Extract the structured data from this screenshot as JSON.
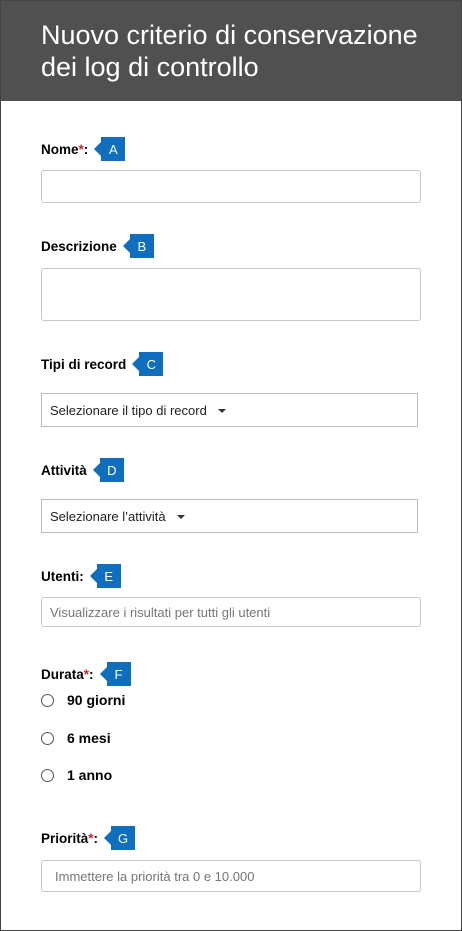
{
  "header": {
    "title": "Nuovo criterio di conservazione dei log di controllo"
  },
  "form": {
    "name": {
      "label": "Nome",
      "required_mark": "*",
      "colon": ":",
      "callout": "A",
      "value": ""
    },
    "description": {
      "label": "Descrizione",
      "callout": "B",
      "value": ""
    },
    "record_types": {
      "label": "Tipi di record",
      "callout": "C",
      "selected": "Selezionare il tipo di record"
    },
    "activities": {
      "label": "Attività",
      "callout": "D",
      "selected": "Selezionare l’attività"
    },
    "users": {
      "label": "Utenti:",
      "callout": "E",
      "placeholder": "Visualizzare i risultati per tutti gli utenti"
    },
    "duration": {
      "label": "Durata",
      "required_mark": "*",
      "colon": ":",
      "callout": "F",
      "options": [
        {
          "label": "90 giorni",
          "selected": false
        },
        {
          "label": "6 mesi",
          "selected": false
        },
        {
          "label": "1 anno",
          "selected": false
        }
      ]
    },
    "priority": {
      "label": "Priorità",
      "required_mark": "*",
      "colon": ":",
      "callout": "G",
      "placeholder": "Immettere la priorità tra 0 e 10.000"
    }
  }
}
